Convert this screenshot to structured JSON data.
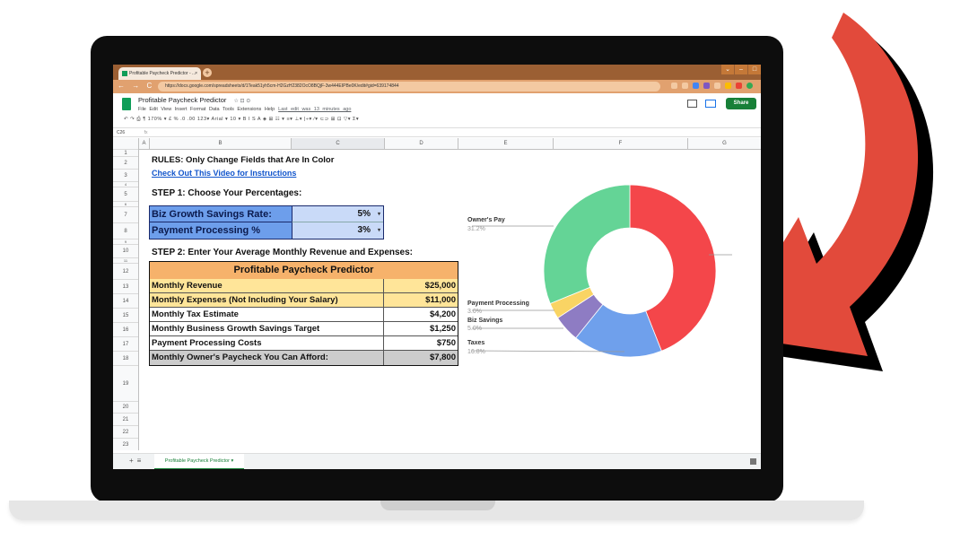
{
  "browser": {
    "tab_title": "Profitable Paycheck Predictor - ...",
    "tab_close": "×",
    "new_tab": "+",
    "nav_buttons": "← → C ⌂",
    "url": "https://docs.google.com/spreadsheets/d/1Teak51yh5cm-H2GzH2382OcO8BQjF-3w444EIPBe0K/edit#gid=639174844",
    "window_controls": [
      "⌄",
      "–",
      "□"
    ]
  },
  "docs": {
    "title": "Profitable Paycheck Predictor",
    "title_icons": "☆ ⊡ ⊙",
    "menus": "File Edit View Insert Format Data Tools Extensions Help",
    "last_edit": "Last edit was 13 minutes ago",
    "share_label": "Share",
    "toolbar": "↶ ↷ ⎙ ¶  170% ▾  £ % .0 .00 123▾  Arial ▾  10 ▾  B I S A  ◈ ⊞ ☷ ▾  ≡▾ ⊥▾ |÷▾ ⁄▾  ⊂⊃ ⊞ ⊡ ▽▾ Σ▾",
    "cell_ref": "C26",
    "fx": "fx"
  },
  "grid": {
    "columns": [
      "A",
      "B",
      "C",
      "D",
      "E",
      "F",
      "G"
    ],
    "rows": [
      "1",
      "2",
      "3",
      "4",
      "5",
      "6",
      "7",
      "8",
      "9",
      "10",
      "11",
      "12",
      "13",
      "14",
      "15",
      "16",
      "17",
      "18",
      "19",
      "20",
      "21",
      "22",
      "23"
    ]
  },
  "sheet": {
    "rules": "RULES: Only Change Fields that Are In Color",
    "video_link": "Check Out This Video for Instructions",
    "step1": "STEP 1: Choose Your Percentages:",
    "step2": "STEP 2: Enter Your Average Monthly Revenue and Expenses:",
    "percentages": [
      {
        "label": "Biz Growth Savings Rate:",
        "value": "5%"
      },
      {
        "label": "Payment Processing %",
        "value": "3%"
      }
    ],
    "predictor": {
      "title": "Profitable Paycheck Predictor",
      "rows": [
        {
          "label": "Monthly Revenue",
          "value": "$25,000"
        },
        {
          "label": "Monthly Expenses (Not Including Your Salary)",
          "value": "$11,000"
        },
        {
          "label": "Monthly Tax Estimate",
          "value": "$4,200"
        },
        {
          "label": "Monthly Business Growth Savings Target",
          "value": "$1,250"
        },
        {
          "label": "Payment Processing Costs",
          "value": "$750"
        },
        {
          "label": "Monthly Owner's Paycheck You Can Afford:",
          "value": "$7,800"
        }
      ]
    }
  },
  "chart_data": {
    "type": "pie",
    "donut": true,
    "slices": [
      {
        "label": "",
        "value": 44.0,
        "color": "#f4464a"
      },
      {
        "label": "Taxes",
        "value": 16.8,
        "percent_text": "16.8%",
        "color": "#6fa0ec"
      },
      {
        "label": "Biz Savings",
        "value": 5.0,
        "percent_text": "5.0%",
        "color": "#8e7cc3"
      },
      {
        "label": "Payment Processing",
        "value": 3.0,
        "percent_text": "3.0%",
        "color": "#f9d464"
      },
      {
        "label": "Owner's Pay",
        "value": 31.2,
        "percent_text": "31.2%",
        "color": "#64d496"
      }
    ]
  },
  "bottom": {
    "add": "+",
    "list": "≡",
    "sheet_tab": "Profitable Paycheck Predictor ▾"
  },
  "colors": {
    "arrow": "#e24a3b",
    "share": "#188038",
    "header_orange": "#f6b26b",
    "pct_blue": "#6d9eeb"
  }
}
